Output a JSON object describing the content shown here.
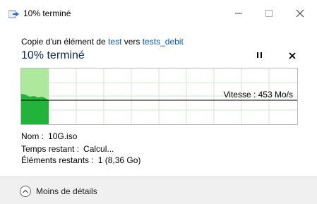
{
  "window": {
    "title": "10% terminé",
    "controls": {
      "minimize": "minimize-icon",
      "maximize": "maximize-icon",
      "close": "close-icon"
    }
  },
  "header": {
    "copy_prefix": "Copie d'un élément de",
    "source": "test",
    "connector": "vers",
    "destination": "tests_debit",
    "progress_title": "10% terminé"
  },
  "graph": {
    "speed_label": "Vitesse : 453 Mo/s",
    "progress_fraction": 0.1,
    "colors": {
      "done": "#aee89d",
      "throughput": "#22b33a",
      "grid": "#cfe8cf"
    }
  },
  "details": {
    "name_label": "Nom :",
    "name_value": "10G.iso",
    "time_label": "Temps restant :",
    "time_value": "Calcul...",
    "items_label": "Éléments restants :",
    "items_value": "1 (8,36 Go)"
  },
  "footer": {
    "toggle_label": "Moins de détails"
  }
}
